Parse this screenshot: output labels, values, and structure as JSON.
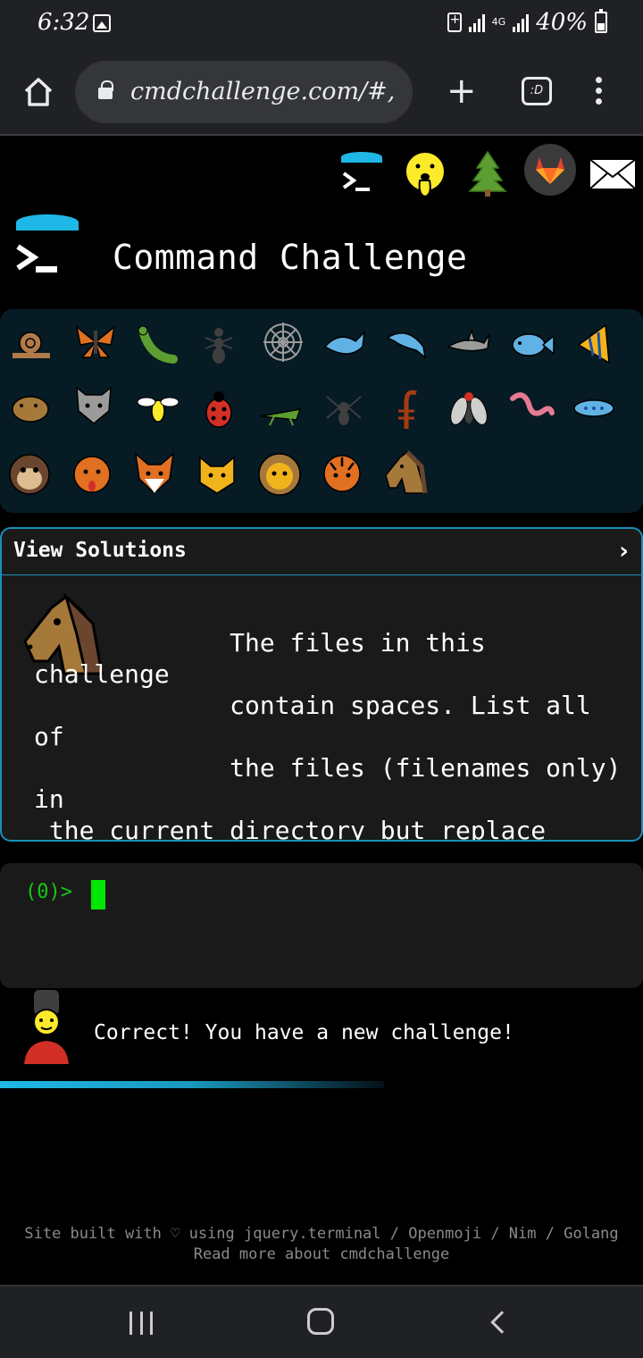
{
  "status_bar": {
    "time": "6:32",
    "network": "4G",
    "battery": "40%"
  },
  "browser": {
    "url": "cmdchallenge.com/#,",
    "tabs_label": ":D"
  },
  "header": {
    "title": "Command Challenge",
    "icons": [
      "terminal-logo-icon",
      "shushing-face-icon",
      "tree-icon",
      "gitlab-icon",
      "envelope-icon"
    ]
  },
  "animals": {
    "rows": [
      [
        "snail",
        "butterfly",
        "bug",
        "ant",
        "spider-web",
        "whale",
        "dolphin",
        "shark",
        "fish",
        "tropical-fish"
      ],
      [
        "hedgehog",
        "wolf",
        "bee",
        "ladybug",
        "cricket",
        "spider",
        "scorpion",
        "fly",
        "worm",
        "microbe"
      ],
      [
        "monkey",
        "dog",
        "fox",
        "cat",
        "lion",
        "tiger",
        "horse"
      ]
    ]
  },
  "solutions": {
    "title": "View Solutions",
    "chevron": "›",
    "challenge_text": "             The files in this challenge\n             contain spaces. List all of\n             the files (filenames only) in\n the current directory but replace\n all spaces with a '.' character."
  },
  "terminal": {
    "prompt": "(0)>"
  },
  "feedback": {
    "message": "Correct! You have a new challenge!"
  },
  "footer": {
    "line1": "Site built with ♡ using jquery.terminal / Openmoji / Nim / Golang",
    "line2": "Read more about cmdchallenge"
  },
  "colors": {
    "accent": "#1fb8e6",
    "prompt": "#14c814",
    "cursor": "#00e600"
  }
}
